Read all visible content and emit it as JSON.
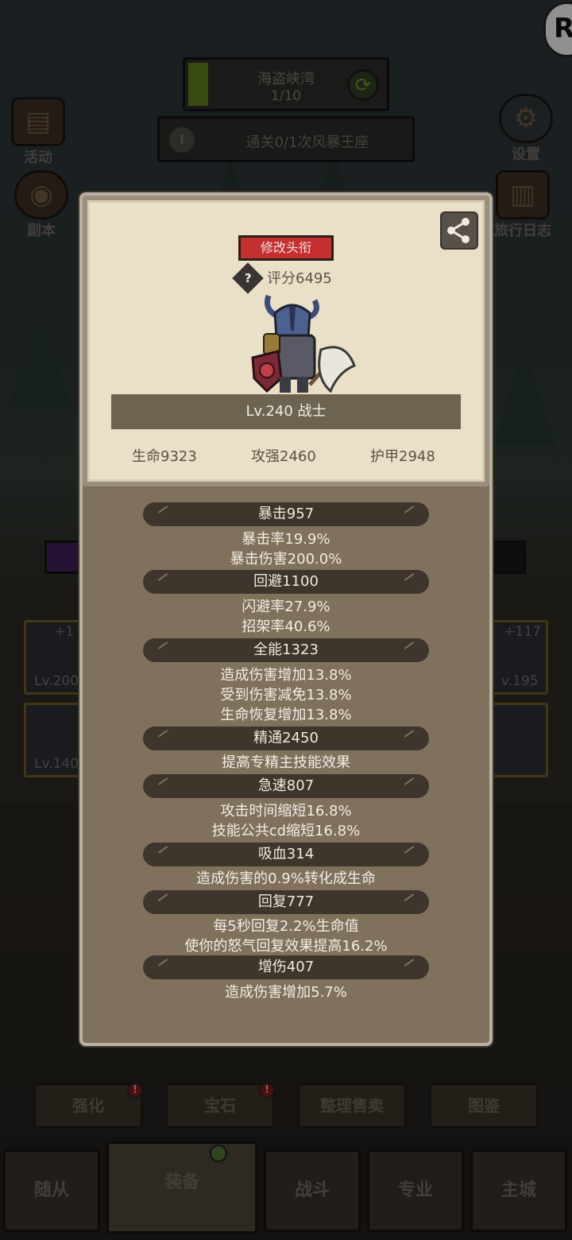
{
  "background": {
    "stage": {
      "name": "海盗峡湾",
      "progress_text": "1/10",
      "progress": 0.1
    },
    "quest": {
      "text": "通关0/1次风暴王座"
    },
    "left_menu": [
      {
        "label": "活动",
        "icon": "scroll-icon"
      },
      {
        "label": "副本",
        "icon": "portal-icon"
      }
    ],
    "right_menu": [
      {
        "label": "设置",
        "icon": "gear-icon"
      },
      {
        "label": "旅行日志",
        "icon": "book-icon"
      }
    ],
    "equipment_slots": [
      {
        "level": "Lv.200",
        "plus": "+1"
      },
      {
        "level": "Lv.140",
        "plus": ""
      },
      {
        "level": "v.195",
        "plus": "+117"
      }
    ],
    "actions": [
      {
        "label": "强化",
        "alert": true
      },
      {
        "label": "宝石",
        "alert": true
      },
      {
        "label": "整理售卖",
        "alert": false
      },
      {
        "label": "图鉴",
        "alert": false
      }
    ],
    "nav": [
      {
        "label": "随从",
        "active": false
      },
      {
        "label": "装备",
        "active": true
      },
      {
        "label": "战斗",
        "active": false
      },
      {
        "label": "专业",
        "active": false
      },
      {
        "label": "主城",
        "active": false
      }
    ],
    "logo_letter": "R"
  },
  "profile": {
    "title_button": "修改头衔",
    "score": "评分6495",
    "help_symbol": "?",
    "level_class": "Lv.240 战士",
    "base_stats": {
      "hp": "生命9323",
      "attack": "攻强2460",
      "armor": "护甲2948"
    }
  },
  "stats": [
    {
      "header": "暴击957",
      "lines": [
        "暴击率19.9%",
        "暴击伤害200.0%"
      ]
    },
    {
      "header": "回避1100",
      "lines": [
        "闪避率27.9%",
        "招架率40.6%"
      ]
    },
    {
      "header": "全能1323",
      "lines": [
        "造成伤害增加13.8%",
        "受到伤害减免13.8%",
        "生命恢复增加13.8%"
      ]
    },
    {
      "header": "精通2450",
      "lines": [
        "提高专精主技能效果"
      ]
    },
    {
      "header": "急速807",
      "lines": [
        "攻击时间缩短16.8%",
        "技能公共cd缩短16.8%"
      ]
    },
    {
      "header": "吸血314",
      "lines": [
        "造成伤害的0.9%转化成生命"
      ]
    },
    {
      "header": "回复777",
      "lines": [
        "每5秒回复2.2%生命值",
        "使你的怒气回复效果提高16.2%"
      ]
    },
    {
      "header": "增伤407",
      "lines": [
        "造成伤害增加5.7%"
      ]
    }
  ]
}
